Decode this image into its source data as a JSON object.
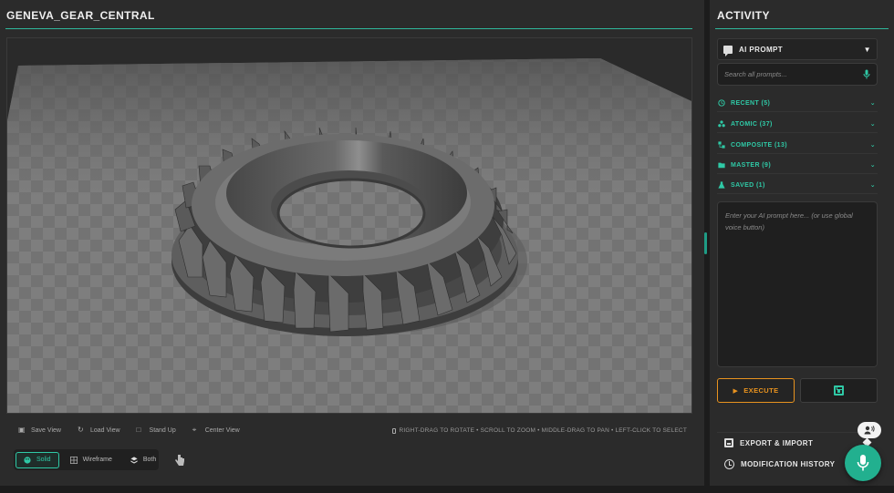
{
  "model_title": "GENEVA_GEAR_CENTRAL",
  "view_actions": [
    {
      "label": "Save View",
      "icon": "save-view-icon"
    },
    {
      "label": "Load View",
      "icon": "load-view-icon"
    },
    {
      "label": "Stand Up",
      "icon": "stand-up-icon"
    },
    {
      "label": "Center View",
      "icon": "center-view-icon"
    }
  ],
  "controls_hint": "RIGHT-DRAG TO ROTATE • SCROLL TO ZOOM • MIDDLE-DRAG TO PAN • LEFT-CLICK TO SELECT",
  "render_modes": [
    {
      "label": "Solid",
      "active": true
    },
    {
      "label": "Wireframe",
      "active": false
    },
    {
      "label": "Both",
      "active": false
    }
  ],
  "sidebar": {
    "title": "ACTIVITY",
    "ai_prompt_label": "AI PROMPT",
    "search_placeholder": "Search all prompts...",
    "categories": [
      {
        "label": "RECENT (5)",
        "icon": "history-icon"
      },
      {
        "label": "ATOMIC (37)",
        "icon": "atoms-icon"
      },
      {
        "label": "COMPOSITE (13)",
        "icon": "composite-icon"
      },
      {
        "label": "MASTER (9)",
        "icon": "folder-icon"
      },
      {
        "label": "SAVED (1)",
        "icon": "flask-icon"
      }
    ],
    "prompt_placeholder": "Enter your AI prompt here... (or use global voice button)",
    "execute_label": "EXECUTE",
    "export_label": "EXPORT & IMPORT",
    "history_label": "MODIFICATION HISTORY"
  },
  "colors": {
    "accent": "#2fc9a6",
    "execute": "#e8931f",
    "panel": "#2b2b2b",
    "background": "#1c1c1c"
  }
}
